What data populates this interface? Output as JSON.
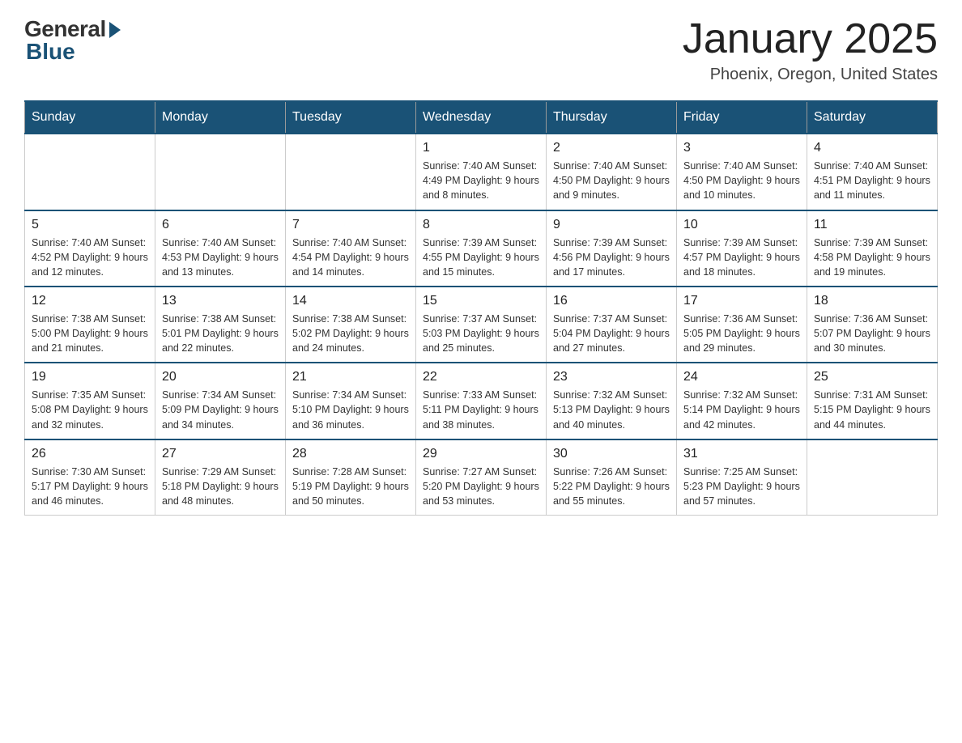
{
  "logo": {
    "general": "General",
    "blue": "Blue"
  },
  "title": "January 2025",
  "location": "Phoenix, Oregon, United States",
  "days_of_week": [
    "Sunday",
    "Monday",
    "Tuesday",
    "Wednesday",
    "Thursday",
    "Friday",
    "Saturday"
  ],
  "weeks": [
    [
      {
        "day": "",
        "info": ""
      },
      {
        "day": "",
        "info": ""
      },
      {
        "day": "",
        "info": ""
      },
      {
        "day": "1",
        "info": "Sunrise: 7:40 AM\nSunset: 4:49 PM\nDaylight: 9 hours and 8 minutes."
      },
      {
        "day": "2",
        "info": "Sunrise: 7:40 AM\nSunset: 4:50 PM\nDaylight: 9 hours and 9 minutes."
      },
      {
        "day": "3",
        "info": "Sunrise: 7:40 AM\nSunset: 4:50 PM\nDaylight: 9 hours and 10 minutes."
      },
      {
        "day": "4",
        "info": "Sunrise: 7:40 AM\nSunset: 4:51 PM\nDaylight: 9 hours and 11 minutes."
      }
    ],
    [
      {
        "day": "5",
        "info": "Sunrise: 7:40 AM\nSunset: 4:52 PM\nDaylight: 9 hours and 12 minutes."
      },
      {
        "day": "6",
        "info": "Sunrise: 7:40 AM\nSunset: 4:53 PM\nDaylight: 9 hours and 13 minutes."
      },
      {
        "day": "7",
        "info": "Sunrise: 7:40 AM\nSunset: 4:54 PM\nDaylight: 9 hours and 14 minutes."
      },
      {
        "day": "8",
        "info": "Sunrise: 7:39 AM\nSunset: 4:55 PM\nDaylight: 9 hours and 15 minutes."
      },
      {
        "day": "9",
        "info": "Sunrise: 7:39 AM\nSunset: 4:56 PM\nDaylight: 9 hours and 17 minutes."
      },
      {
        "day": "10",
        "info": "Sunrise: 7:39 AM\nSunset: 4:57 PM\nDaylight: 9 hours and 18 minutes."
      },
      {
        "day": "11",
        "info": "Sunrise: 7:39 AM\nSunset: 4:58 PM\nDaylight: 9 hours and 19 minutes."
      }
    ],
    [
      {
        "day": "12",
        "info": "Sunrise: 7:38 AM\nSunset: 5:00 PM\nDaylight: 9 hours and 21 minutes."
      },
      {
        "day": "13",
        "info": "Sunrise: 7:38 AM\nSunset: 5:01 PM\nDaylight: 9 hours and 22 minutes."
      },
      {
        "day": "14",
        "info": "Sunrise: 7:38 AM\nSunset: 5:02 PM\nDaylight: 9 hours and 24 minutes."
      },
      {
        "day": "15",
        "info": "Sunrise: 7:37 AM\nSunset: 5:03 PM\nDaylight: 9 hours and 25 minutes."
      },
      {
        "day": "16",
        "info": "Sunrise: 7:37 AM\nSunset: 5:04 PM\nDaylight: 9 hours and 27 minutes."
      },
      {
        "day": "17",
        "info": "Sunrise: 7:36 AM\nSunset: 5:05 PM\nDaylight: 9 hours and 29 minutes."
      },
      {
        "day": "18",
        "info": "Sunrise: 7:36 AM\nSunset: 5:07 PM\nDaylight: 9 hours and 30 minutes."
      }
    ],
    [
      {
        "day": "19",
        "info": "Sunrise: 7:35 AM\nSunset: 5:08 PM\nDaylight: 9 hours and 32 minutes."
      },
      {
        "day": "20",
        "info": "Sunrise: 7:34 AM\nSunset: 5:09 PM\nDaylight: 9 hours and 34 minutes."
      },
      {
        "day": "21",
        "info": "Sunrise: 7:34 AM\nSunset: 5:10 PM\nDaylight: 9 hours and 36 minutes."
      },
      {
        "day": "22",
        "info": "Sunrise: 7:33 AM\nSunset: 5:11 PM\nDaylight: 9 hours and 38 minutes."
      },
      {
        "day": "23",
        "info": "Sunrise: 7:32 AM\nSunset: 5:13 PM\nDaylight: 9 hours and 40 minutes."
      },
      {
        "day": "24",
        "info": "Sunrise: 7:32 AM\nSunset: 5:14 PM\nDaylight: 9 hours and 42 minutes."
      },
      {
        "day": "25",
        "info": "Sunrise: 7:31 AM\nSunset: 5:15 PM\nDaylight: 9 hours and 44 minutes."
      }
    ],
    [
      {
        "day": "26",
        "info": "Sunrise: 7:30 AM\nSunset: 5:17 PM\nDaylight: 9 hours and 46 minutes."
      },
      {
        "day": "27",
        "info": "Sunrise: 7:29 AM\nSunset: 5:18 PM\nDaylight: 9 hours and 48 minutes."
      },
      {
        "day": "28",
        "info": "Sunrise: 7:28 AM\nSunset: 5:19 PM\nDaylight: 9 hours and 50 minutes."
      },
      {
        "day": "29",
        "info": "Sunrise: 7:27 AM\nSunset: 5:20 PM\nDaylight: 9 hours and 53 minutes."
      },
      {
        "day": "30",
        "info": "Sunrise: 7:26 AM\nSunset: 5:22 PM\nDaylight: 9 hours and 55 minutes."
      },
      {
        "day": "31",
        "info": "Sunrise: 7:25 AM\nSunset: 5:23 PM\nDaylight: 9 hours and 57 minutes."
      },
      {
        "day": "",
        "info": ""
      }
    ]
  ]
}
